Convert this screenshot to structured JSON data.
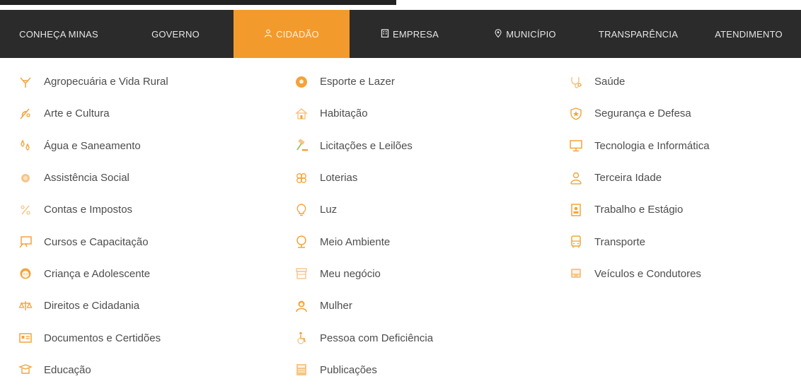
{
  "nav": {
    "items": [
      {
        "label": "CONHEÇA MINAS",
        "icon": ""
      },
      {
        "label": "GOVERNO",
        "icon": ""
      },
      {
        "label": "CIDADÃO",
        "icon": "person-icon"
      },
      {
        "label": "EMPRESA",
        "icon": "building-icon"
      },
      {
        "label": "MUNICÍPIO",
        "icon": "pin-icon"
      },
      {
        "label": "TRANSPARÊNCIA",
        "icon": ""
      },
      {
        "label": "ATENDIMENTO",
        "icon": ""
      }
    ],
    "active_index": 2,
    "accent_color": "#f39a2c",
    "background_color": "#2b2b2b"
  },
  "menu": {
    "col1": [
      {
        "label": "Agropecuária e Vida Rural",
        "icon": "tractor-icon"
      },
      {
        "label": "Arte e Cultura",
        "icon": "palette-icon"
      },
      {
        "label": "Água e Saneamento",
        "icon": "water-drops-icon"
      },
      {
        "label": "Assistência Social",
        "icon": "hands-icon"
      },
      {
        "label": "Contas e Impostos",
        "icon": "percent-icon"
      },
      {
        "label": "Cursos e Capacitação",
        "icon": "presentation-board-icon"
      },
      {
        "label": "Criança e Adolescente",
        "icon": "child-face-icon"
      },
      {
        "label": "Direitos e Cidadania",
        "icon": "scales-icon"
      },
      {
        "label": "Documentos e Certidões",
        "icon": "id-card-icon"
      },
      {
        "label": "Educação",
        "icon": "graduation-cap-icon"
      }
    ],
    "col2": [
      {
        "label": "Esporte e Lazer",
        "icon": "soccer-ball-icon"
      },
      {
        "label": "Habitação",
        "icon": "house-icon"
      },
      {
        "label": "Licitações e Leilões",
        "icon": "gavel-icon"
      },
      {
        "label": "Loterias",
        "icon": "clover-icon"
      },
      {
        "label": "Luz",
        "icon": "lightbulb-icon"
      },
      {
        "label": "Meio Ambiente",
        "icon": "tree-icon"
      },
      {
        "label": "Meu negócio",
        "icon": "store-icon"
      },
      {
        "label": "Mulher",
        "icon": "woman-icon"
      },
      {
        "label": "Pessoa com Deficiência",
        "icon": "accessibility-icon"
      },
      {
        "label": "Publicações",
        "icon": "newspaper-icon"
      }
    ],
    "col3": [
      {
        "label": "Saúde",
        "icon": "stethoscope-icon"
      },
      {
        "label": "Segurança e Defesa",
        "icon": "shield-badge-icon"
      },
      {
        "label": "Tecnologia e Informática",
        "icon": "monitor-icon"
      },
      {
        "label": "Terceira Idade",
        "icon": "elderly-icon"
      },
      {
        "label": "Trabalho e Estágio",
        "icon": "work-badge-icon"
      },
      {
        "label": "Transporte",
        "icon": "bus-icon"
      },
      {
        "label": "Veículos e Condutores",
        "icon": "car-icon"
      }
    ]
  }
}
